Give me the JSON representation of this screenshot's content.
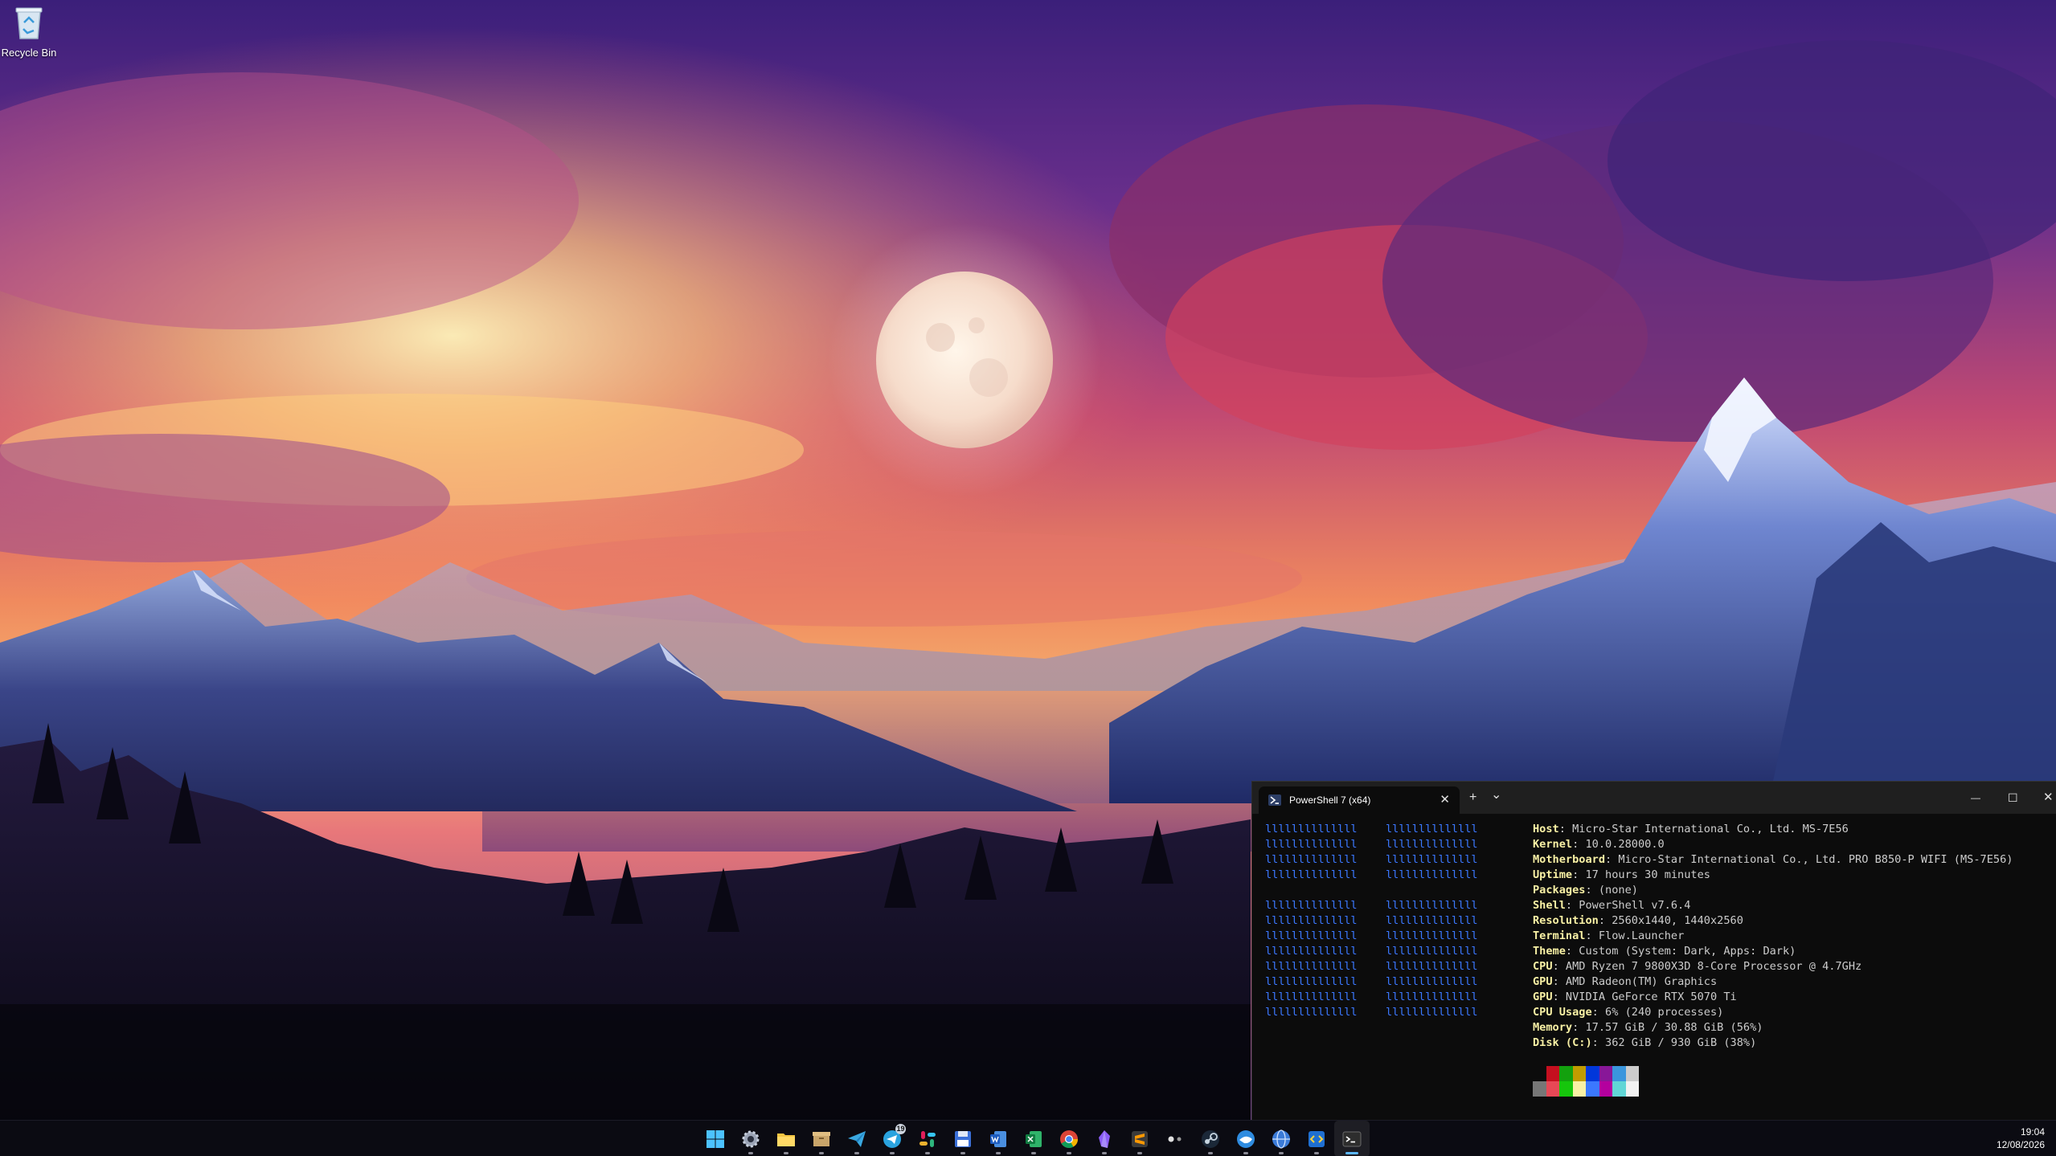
{
  "desktop": {
    "recycle_bin_label": "Recycle Bin"
  },
  "terminal": {
    "tab_title": "PowerShell 7 (x64)",
    "tab_close_glyph": "✕",
    "new_tab_glyph": "+",
    "dropdown_glyph": "⌄",
    "minimize_glyph": "—",
    "maximize_glyph": "☐",
    "close_glyph": "✕",
    "logo_line": "llllllllllllll",
    "info": [
      {
        "key": "Host",
        "value": " Micro-Star International Co., Ltd. MS-7E56"
      },
      {
        "key": "Kernel",
        "value": " 10.0.28000.0"
      },
      {
        "key": "Motherboard",
        "value": " Micro-Star International Co., Ltd. PRO B850-P WIFI (MS-7E56)"
      },
      {
        "key": "Uptime",
        "value": " 17 hours 30 minutes"
      },
      {
        "key": "Packages",
        "value": " (none)"
      },
      {
        "key": "Shell",
        "value": " PowerShell v7.6.4"
      },
      {
        "key": "Resolution",
        "value": " 2560x1440, 1440x2560"
      },
      {
        "key": "Terminal",
        "value": " Flow.Launcher"
      },
      {
        "key": "Theme",
        "value": " Custom (System: Dark, Apps: Dark)"
      },
      {
        "key": "CPU",
        "value": " AMD Ryzen 7 9800X3D 8-Core Processor @ 4.7GHz"
      },
      {
        "key": "GPU",
        "value": " AMD Radeon(TM) Graphics"
      },
      {
        "key": "GPU",
        "value": " NVIDIA GeForce RTX 5070 Ti"
      },
      {
        "key": "CPU Usage",
        "value": " 6% (240 processes)"
      },
      {
        "key": "Memory",
        "value": " 17.57 GiB / 30.88 GiB (56%)"
      },
      {
        "key": "Disk (C:)",
        "value": " 362 GiB / 930 GiB (38%)"
      }
    ],
    "palette_top": [
      "#0c0c0c",
      "#c50f1f",
      "#13a10e",
      "#c19c00",
      "#0037da",
      "#881798",
      "#3a96dd",
      "#cccccc"
    ],
    "palette_bottom": [
      "#767676",
      "#e74856",
      "#16c60c",
      "#f9f1a5",
      "#3b78ff",
      "#b4009e",
      "#61d6d6",
      "#f2f2f2"
    ],
    "logo_color": "#3b78ff",
    "key_color": "#f9f1a5"
  },
  "taskbar": {
    "apps": [
      {
        "name": "start",
        "icon": "windows-logo-icon",
        "running": false
      },
      {
        "name": "settings",
        "icon": "gear-icon",
        "running": true
      },
      {
        "name": "file-explorer",
        "icon": "folder-icon",
        "running": true
      },
      {
        "name": "archive",
        "icon": "archive-box-icon",
        "running": true
      },
      {
        "name": "telegram-a",
        "icon": "paper-plane-icon",
        "running": true
      },
      {
        "name": "telegram-b",
        "icon": "telegram-icon",
        "running": true,
        "badge": "19"
      },
      {
        "name": "slack",
        "icon": "slack-icon",
        "running": true
      },
      {
        "name": "save-app",
        "icon": "floppy-disk-icon",
        "running": true
      },
      {
        "name": "word",
        "icon": "word-icon",
        "running": true
      },
      {
        "name": "excel",
        "icon": "excel-icon",
        "running": true
      },
      {
        "name": "chrome",
        "icon": "chrome-icon",
        "running": true
      },
      {
        "name": "obsidian",
        "icon": "obsidian-icon",
        "running": true
      },
      {
        "name": "sublime",
        "icon": "sublime-text-icon",
        "running": true
      },
      {
        "name": "media",
        "icon": "dots-icon",
        "running": false
      },
      {
        "name": "steam",
        "icon": "steam-icon",
        "running": true
      },
      {
        "name": "whale",
        "icon": "whale-icon",
        "running": true
      },
      {
        "name": "globe",
        "icon": "globe-icon",
        "running": true
      },
      {
        "name": "vscode",
        "icon": "code-editor-icon",
        "running": true
      },
      {
        "name": "terminal",
        "icon": "terminal-icon",
        "running": true,
        "active": true
      }
    ],
    "clock_time": "19:04",
    "clock_date": "12/08/2026"
  }
}
